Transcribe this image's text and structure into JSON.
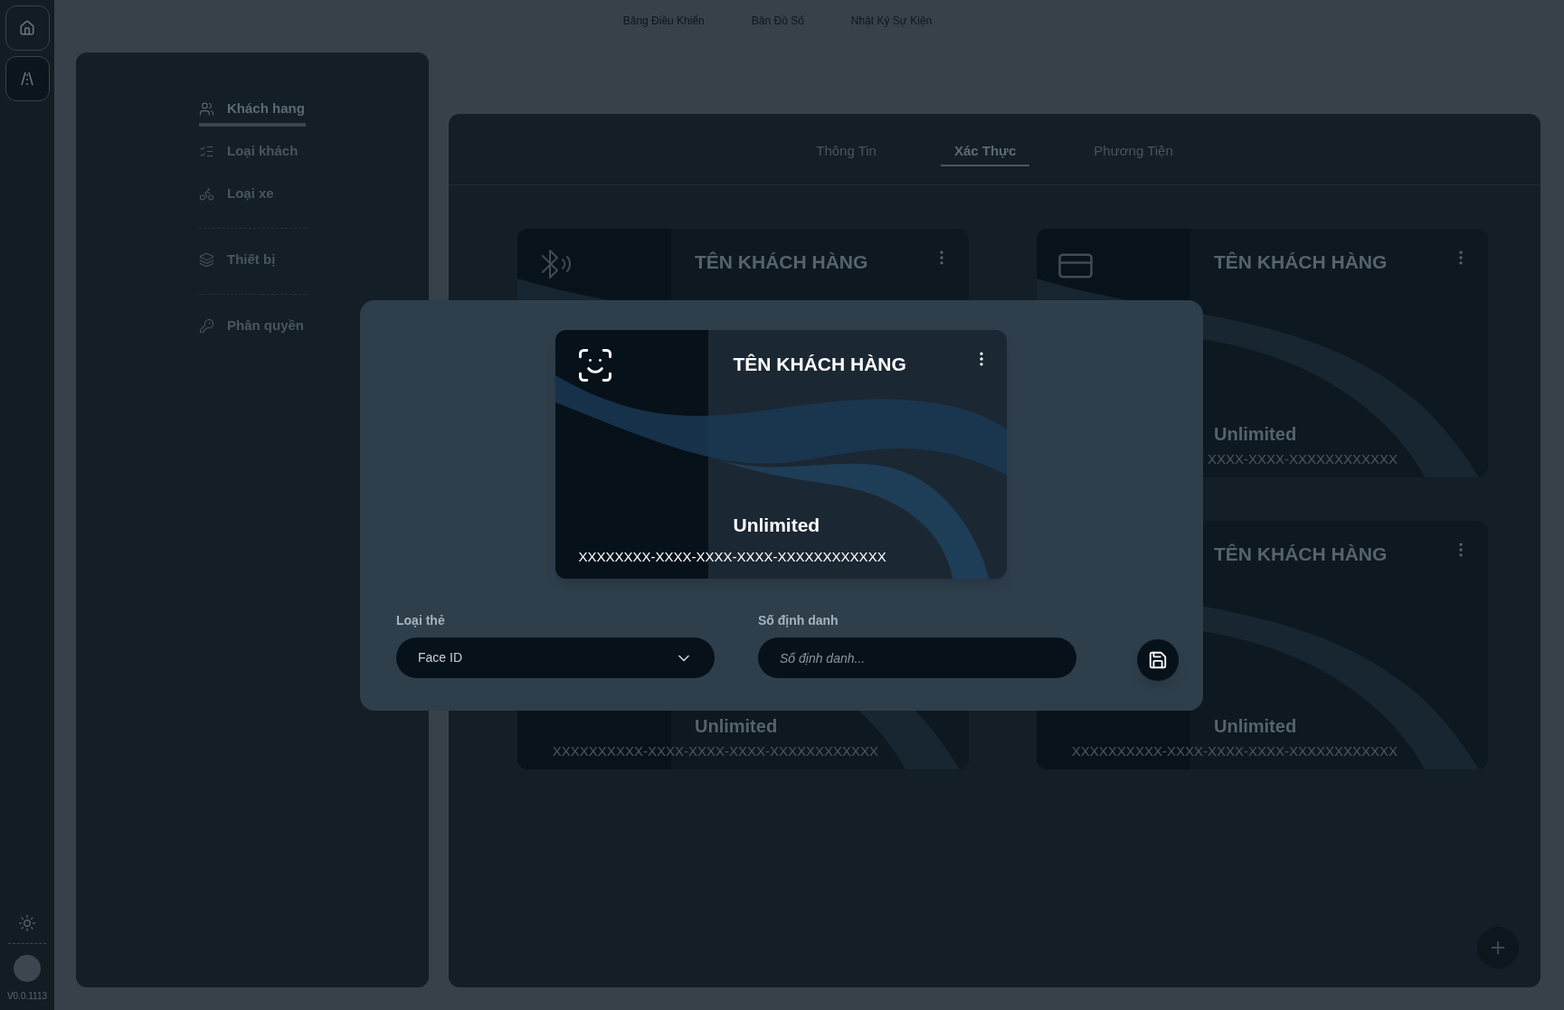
{
  "rail": {
    "version": "V0.0.1113"
  },
  "top_nav": {
    "items": [
      {
        "label": "Bảng Điều Khiển"
      },
      {
        "label": "Bản Đồ Số"
      },
      {
        "label": "Nhật Ký Sự Kiện"
      }
    ]
  },
  "sidebar": {
    "groups": [
      [
        {
          "label": "Khách hang",
          "selected": true
        },
        {
          "label": "Loại khách",
          "selected": false
        },
        {
          "label": "Loại xe",
          "selected": false
        }
      ],
      [
        {
          "label": "Thiết bị",
          "selected": false
        }
      ],
      [
        {
          "label": "Phân quyền",
          "selected": false
        }
      ]
    ]
  },
  "tabs": [
    {
      "label": "Thông Tin",
      "selected": false
    },
    {
      "label": "Xác Thực",
      "selected": true
    },
    {
      "label": "Phương Tiện",
      "selected": false
    }
  ],
  "cards": [
    {
      "kind": "bluetooth",
      "title": "TÊN KHÁCH HÀNG"
    },
    {
      "kind": "card",
      "title": "TÊN KHÁCH HÀNG",
      "plan": "Unlimited",
      "id": "XXXX-XXXX-XXXXXXXXXXXX"
    },
    {
      "kind": "none",
      "plan": "Unlimited",
      "id": "XXXXXXXXXX-XXXX-XXXX-XXXX-XXXXXXXXXXXX"
    },
    {
      "kind": "none",
      "title": "TÊN KHÁCH HÀNG",
      "plan": "Unlimited",
      "id": "XXXXXXXXXX-XXXX-XXXX-XXXX-XXXXXXXXXXXX"
    }
  ],
  "modal": {
    "card": {
      "kind": "face",
      "title": "TÊN KHÁCH HÀNG",
      "plan": "Unlimited",
      "id": "XXXXXXXX-XXXX-XXXX-XXXX-XXXXXXXXXXXX"
    },
    "card_type": {
      "label": "Loại thẻ",
      "value": "Face ID"
    },
    "identifier": {
      "label": "Số định danh",
      "placeholder": "Số định danh..."
    }
  }
}
